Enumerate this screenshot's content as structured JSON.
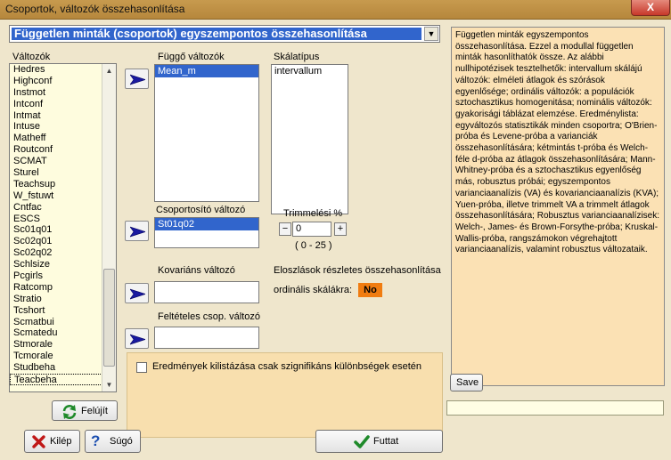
{
  "window": {
    "title": "Csoportok, változók összehasonlítása",
    "close_glyph": "X"
  },
  "module_select": {
    "value": "Független minták (csoportok) egyszempontos összehasonlítása"
  },
  "variables": {
    "label": "Változók",
    "items": [
      "Hedres",
      "Highconf",
      "Instmot",
      "Intconf",
      "Intmat",
      "Intuse",
      "Matheff",
      "Routconf",
      "SCMAT",
      "Sturel",
      "Teachsup",
      "W_fstuwt",
      "Cntfac",
      "ESCS",
      "Sc01q01",
      "Sc02q01",
      "Sc02q02",
      "Schlsize",
      "Pcgirls",
      "Ratcomp",
      "Stratio",
      "Tcshort",
      "Scmatbui",
      "Scmatedu",
      "Stmorale",
      "Tcmorale",
      "Studbeha",
      "Teacbeha"
    ]
  },
  "dependent": {
    "label": "Függő változók",
    "items": [
      "Mean_m"
    ]
  },
  "scale_type": {
    "label": "Skálatípus",
    "items": [
      "intervallum"
    ]
  },
  "grouping": {
    "label": "Csoportosító változó",
    "items": [
      "St01q02"
    ]
  },
  "trim": {
    "label": "Trimmelési %",
    "value": "0",
    "range": "( 0 - 25 )",
    "minus": "−",
    "plus": "+"
  },
  "covariate": {
    "label": "Kovariáns változó",
    "value": ""
  },
  "conditional": {
    "label": "Feltételes csop. változó",
    "value": ""
  },
  "distribution": {
    "line1": "Eloszlások részletes összehasonlítása",
    "line2": "ordinális skálákra:",
    "toggle": "No"
  },
  "significant_only": {
    "label": "Eredmények kilistázása csak szignifikáns különbségek esetén",
    "checked": false
  },
  "description": "Független minták egyszempontos összehasonlítása. Ezzel a modullal független minták hasonlíthatók össze. Az alábbi nullhipotézisek tesztelhetők: intervallum skálájú változók: elméleti átlagok és szórások egyenlősége; ordinális változók: a populációk sztochasztikus homogenitása; nominális változók: gyakorisági táblázat elemzése. Eredménylista: egyváltozós statisztikák minden csoportra; O'Brien-próba és Levene-próba a varianciák összehasonlítására; kétmintás t-próba és Welch-féle d-próba az átlagok összehasonlítására; Mann-Whitney-próba és a sztochasztikus egyenlőség más, robusztus próbái; egyszempontos varianciaanalízis (VA) és kovarianciaanalízis (KVA); Yuen-próba, illetve trimmelt VA a trimmelt átlagok összehasonlítására; Robusztus varianciaanalízisek:  Welch-, James- és Brown-Forsythe-próba; Kruskal-Wallis-próba, rangszámokon végrehajtott varianciaanalízis, valamint robusztus változataik.",
  "buttons": {
    "refresh": "Felújít",
    "save": "Save",
    "exit": "Kilép",
    "help": "Súgó",
    "run": "Futtat"
  },
  "colors": {
    "accent": "#3165cc",
    "toggle_off": "#f07c10",
    "panel": "#f8dfae",
    "list_bg": "#fefcde"
  }
}
